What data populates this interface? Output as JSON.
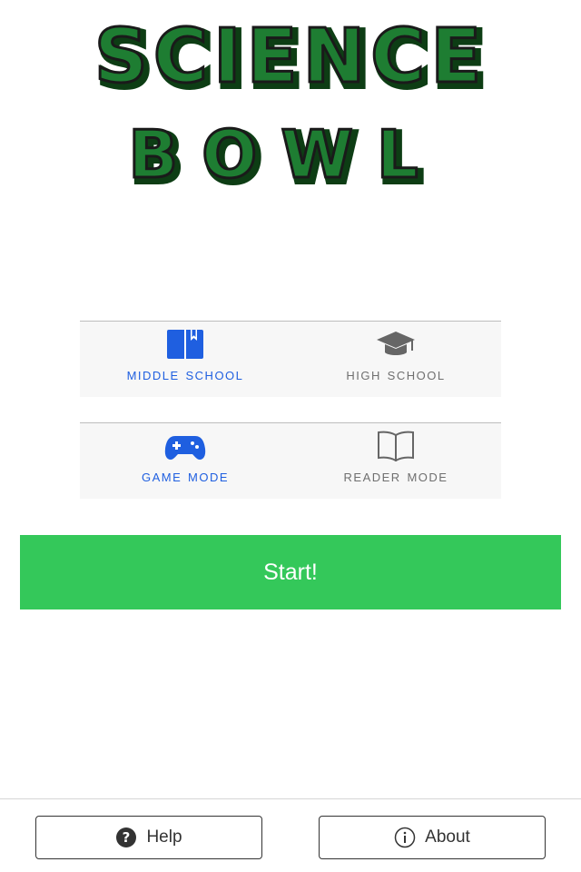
{
  "logo": {
    "line1": "SCIENCE",
    "line2": "BOWL"
  },
  "level_selector": {
    "items": [
      {
        "label": "Middle school",
        "icon": "book-icon",
        "selected": true
      },
      {
        "label": "High school",
        "icon": "graduation-cap-icon",
        "selected": false
      }
    ]
  },
  "mode_selector": {
    "items": [
      {
        "label": "Game mode",
        "icon": "gamepad-icon",
        "selected": true
      },
      {
        "label": "Reader mode",
        "icon": "open-book-icon",
        "selected": false
      }
    ]
  },
  "start_button": {
    "label": "Start!"
  },
  "bottom_bar": {
    "help": {
      "label": "Help",
      "icon": "question-circle-icon"
    },
    "about": {
      "label": "About",
      "icon": "info-circle-icon"
    }
  },
  "colors": {
    "accent_blue": "#1f5fe0",
    "start_green": "#34c85a",
    "logo_green": "#1e7d32",
    "inactive_gray": "#6f6f6f"
  }
}
